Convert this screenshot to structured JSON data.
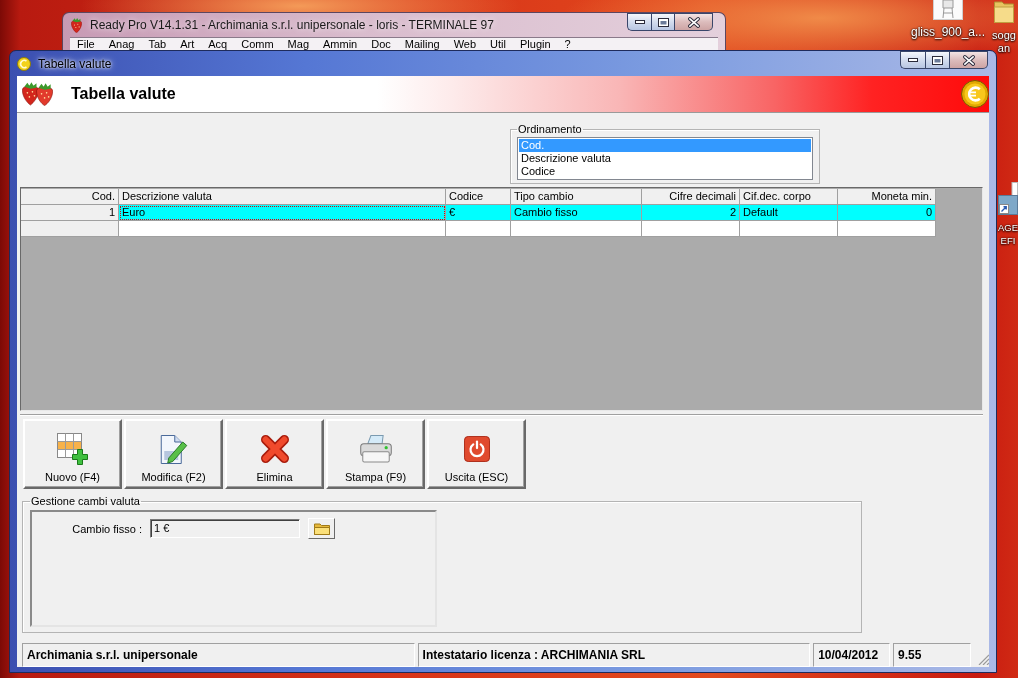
{
  "desktop": {
    "icons": [
      {
        "kind": "image",
        "lines": [
          "gliss_900_a..."
        ]
      },
      {
        "kind": "folder",
        "lines": [
          "sogg",
          "an"
        ]
      },
      {
        "kind": "shortcut",
        "lines": [
          "AGE",
          "EFI"
        ]
      }
    ]
  },
  "background_window": {
    "title": "Ready Pro V14.1.31 - Archimania s.r.l. unipersonale - loris - TERMINALE 97",
    "menu": [
      "File",
      "Anag",
      "Tab",
      "Art",
      "Acq",
      "Comm",
      "Mag",
      "Ammin",
      "Doc",
      "Mailing",
      "Web",
      "Util",
      "Plugin",
      "?"
    ]
  },
  "window": {
    "title": "Tabella valute",
    "header": {
      "title": "Tabella valute"
    },
    "sort": {
      "label": "Ordinamento",
      "options": [
        {
          "label": "Cod.",
          "selected": true
        },
        {
          "label": "Descrizione valuta",
          "selected": false
        },
        {
          "label": "Codice",
          "selected": false
        }
      ]
    },
    "table": {
      "columns": [
        {
          "label": "Cod.",
          "kind": "key"
        },
        {
          "label": "Descrizione valuta",
          "kind": "text"
        },
        {
          "label": "Codice",
          "kind": "text"
        },
        {
          "label": "Tipo cambio",
          "kind": "text"
        },
        {
          "label": "Cifre decimali",
          "kind": "number"
        },
        {
          "label": "Cif.dec. corpo",
          "kind": "text"
        },
        {
          "label": "Moneta min.",
          "kind": "number"
        }
      ],
      "rows": [
        {
          "selected": true,
          "cells": [
            {
              "text": "1",
              "focused": false
            },
            {
              "text": "Euro",
              "focused": true
            },
            {
              "text": "€",
              "focused": false
            },
            {
              "text": "Cambio fisso",
              "focused": false
            },
            {
              "text": "2",
              "focused": false
            },
            {
              "text": "Default",
              "focused": false
            },
            {
              "text": "0",
              "focused": false
            }
          ]
        }
      ],
      "new_row": true
    },
    "buttons": [
      {
        "label": "Nuovo (F4)",
        "kind": "new"
      },
      {
        "label": "Modifica (F2)",
        "kind": "edit"
      },
      {
        "label": "Elimina",
        "kind": "delete"
      },
      {
        "label": "Stampa (F9)",
        "kind": "print"
      },
      {
        "label": "Uscita (ESC)",
        "kind": "exit"
      }
    ],
    "exchange": {
      "label": "Gestione cambi valuta",
      "fields": [
        {
          "label": "Cambio fisso :",
          "value": "1 €",
          "disabled": true
        }
      ]
    },
    "status_bar": [
      "Archimania s.r.l. unipersonale",
      "Intestatario licenza : ARCHIMANIA SRL",
      "10/04/2012",
      "9.55"
    ]
  }
}
